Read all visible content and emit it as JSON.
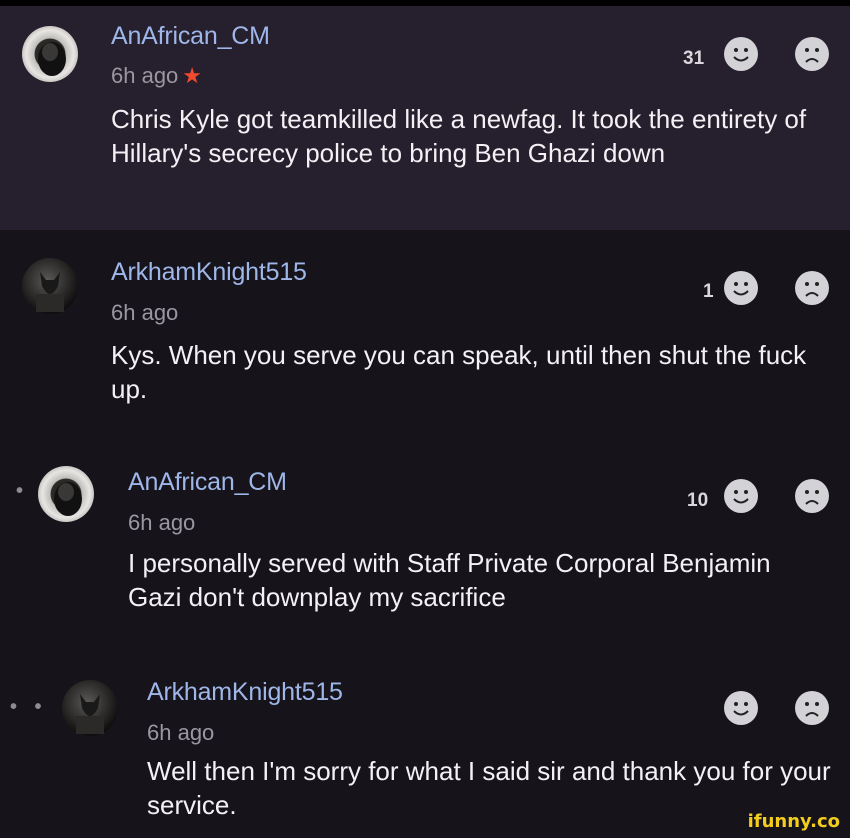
{
  "comments": [
    {
      "username": "AnAfrican_CM",
      "time": "6h ago",
      "starred": true,
      "star_icon": "star-icon",
      "body": "Chris Kyle got teamkilled like a newfag. It took the entirety of Hillary's secrecy police to bring Ben Ghazi down",
      "likes": "31"
    },
    {
      "username": "ArkhamKnight515",
      "time": "6h ago",
      "body": "Kys. When you serve you can speak, until then shut the fuck up.",
      "likes": "1"
    },
    {
      "username": "AnAfrican_CM",
      "time": "6h ago",
      "body": "I personally served with Staff Private Corporal Benjamin Gazi don't downplay my sacrifice",
      "likes": "10"
    },
    {
      "username": "ArkhamKnight515",
      "time": "6h ago",
      "body": "Well then I'm sorry for what I said sir and thank you for your service.",
      "likes": ""
    }
  ],
  "reply_dots": {
    "level1": "•",
    "level2": "• •"
  },
  "watermark": "ifunny.co",
  "colors": {
    "username": "#9fb6e8",
    "star": "#f24a2c",
    "highlight_bg": "#261f2d",
    "page_bg": "#16131a",
    "watermark": "#f2cd1e"
  }
}
